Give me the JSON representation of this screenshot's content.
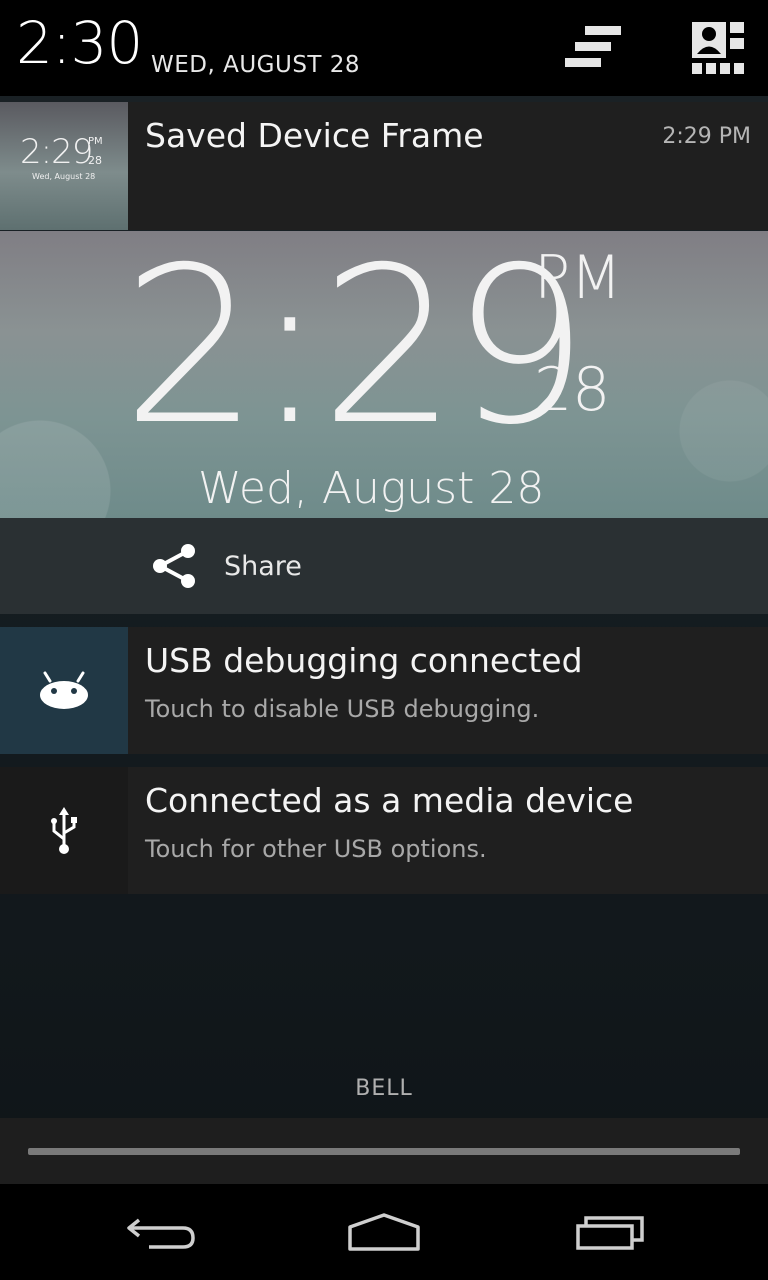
{
  "status_header": {
    "time": "2:30",
    "date": "WED, AUGUST 28",
    "clear_icon": "clear-all-icon",
    "settings_icon": "quick-settings-icon"
  },
  "notifications": [
    {
      "title": "Saved Device Frame",
      "time": "2:29 PM",
      "thumbnail": {
        "time": "2:29",
        "ampm": "PM",
        "seconds": "28",
        "date": "Wed, August 28"
      },
      "big_picture": {
        "time": "2:29",
        "ampm": "PM",
        "seconds": "28",
        "date": "Wed, August 28"
      },
      "action": {
        "label": "Share",
        "icon": "share-icon"
      }
    },
    {
      "title": "USB debugging connected",
      "subtitle": "Touch to disable USB debugging.",
      "icon": "android-icon",
      "icon_bg": "#213845"
    },
    {
      "title": "Connected as a media device",
      "subtitle": "Touch for other USB options.",
      "icon": "usb-icon"
    }
  ],
  "carrier": "BELL",
  "nav_bar": {
    "back": "back-icon",
    "home": "home-icon",
    "recents": "recents-icon"
  }
}
